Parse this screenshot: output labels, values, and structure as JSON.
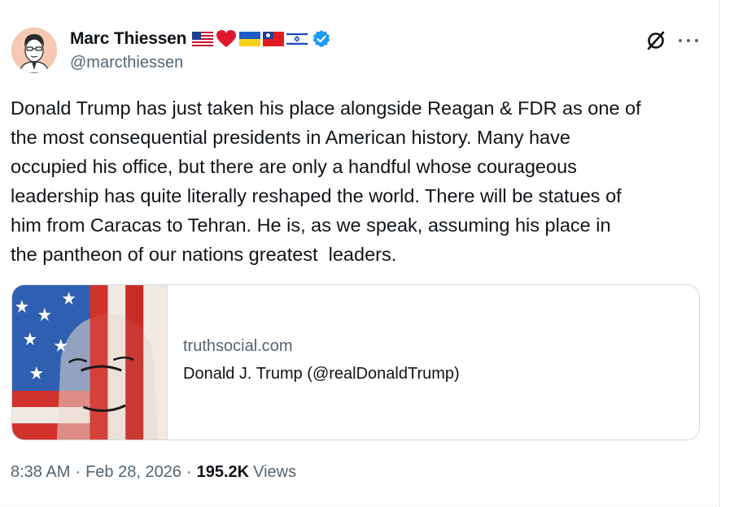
{
  "author": {
    "display_name": "Marc Thiessen",
    "handle": "@marcthiessen",
    "badge_icons": [
      "flag-us-icon",
      "red-heart-icon",
      "flag-ukraine-icon",
      "flag-taiwan-icon",
      "flag-israel-icon",
      "verified-badge-icon"
    ]
  },
  "tweet": {
    "text": "Donald Trump has just taken his place alongside Reagan & FDR as one of\nthe most consequential presidents in American history. Many have\noccupied his office, but there are only a handful whose courageous\nleadership has quite literally reshaped the world. There will be statues of\nhim from Caracas to Tehran. He is, as we speak, assuming his place in\nthe pantheon of our nations greatest  leaders."
  },
  "link_card": {
    "domain": "truthsocial.com",
    "title": "Donald J. Trump (@realDonaldTrump)"
  },
  "meta": {
    "time": "8:38 AM",
    "separator": "·",
    "date": "Feb 28, 2026",
    "views_count": "195.2K",
    "views_label": "Views"
  },
  "colors": {
    "text_primary": "#0f1419",
    "text_secondary": "#536471",
    "verified_blue": "#1d9bf0",
    "border": "#cfd9de"
  }
}
